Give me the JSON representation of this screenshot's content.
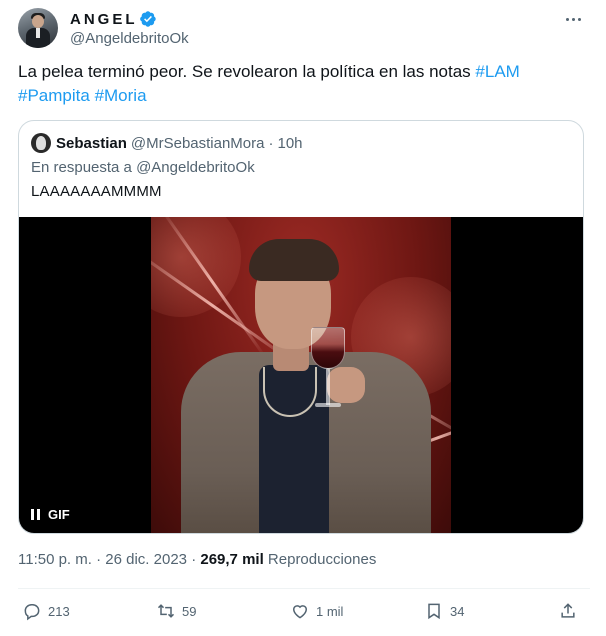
{
  "author": {
    "name": "ANGEL",
    "handle": "@AngeldebritoOk",
    "verified": true
  },
  "tweet": {
    "text": "La pelea terminó peor. Se revolearon la política en las notas ",
    "hashtags": [
      "#LAM",
      "#Pampita",
      "#Moria"
    ]
  },
  "quoted": {
    "name": "Sebastian",
    "handle": "@MrSebastianMora",
    "separator": "·",
    "time": "10h",
    "reply_to": "En respuesta a @AngeldebritoOk",
    "text": "LAAAAAAAMMMM",
    "media_badge": "GIF"
  },
  "meta": {
    "time": "11:50 p. m.",
    "separator": "·",
    "date": "26 dic. 2023",
    "separator2": "·",
    "views_count": "269,7 mil",
    "views_label": "Reproducciones"
  },
  "actions": {
    "replies": "213",
    "retweets": "59",
    "likes": "1 mil",
    "bookmarks": "34"
  },
  "colors": {
    "accent": "#1d9bf0",
    "text_primary": "#0f1419",
    "text_secondary": "#536471",
    "border": "#cfd9de"
  },
  "icons": [
    "verified-badge-icon",
    "more-options-icon",
    "pause-icon",
    "reply-icon",
    "retweet-icon",
    "like-icon",
    "bookmark-icon",
    "share-icon"
  ]
}
